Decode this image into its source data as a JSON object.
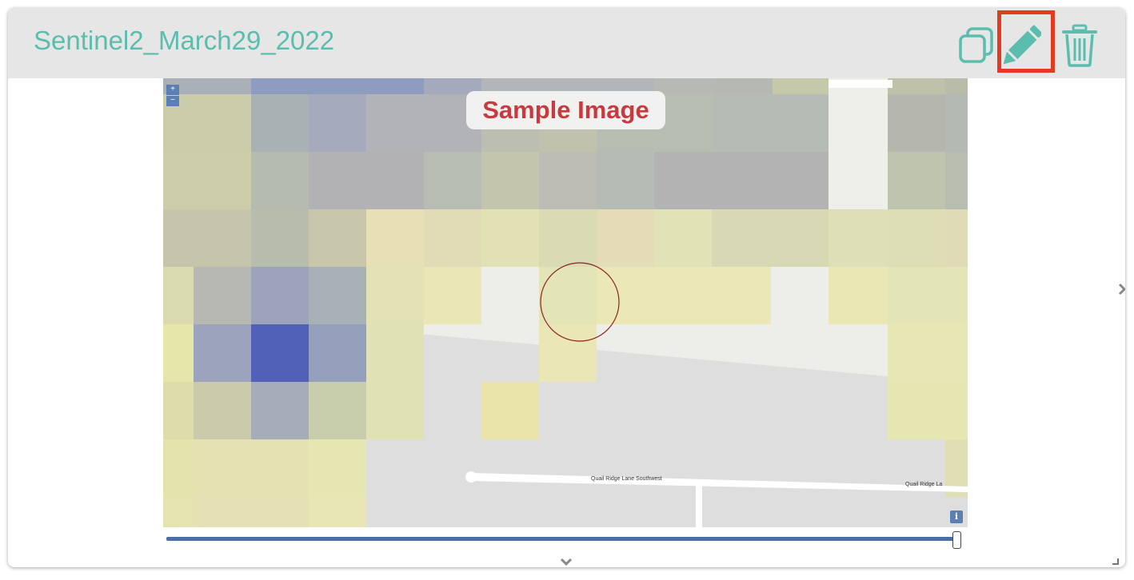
{
  "header": {
    "title": "Sentinel2_March29_2022",
    "accent_color": "#5bbdae",
    "highlight_color": "#e53a22",
    "actions": [
      {
        "icon": "copy-icon"
      },
      {
        "icon": "pencil-icon"
      },
      {
        "icon": "trash-icon"
      }
    ]
  },
  "map": {
    "overlay_label": "Sample Image",
    "zoom_in": "+",
    "zoom_out": "−",
    "street_1": "Quail Ridge Lane Southwest",
    "street_2": "Quail Ridge La",
    "info_label": "i"
  },
  "slider": {
    "value": 1.0
  },
  "icons": {
    "expand": "chevron-down-icon",
    "next": "chevron-right-icon",
    "resize": "resize-handle-icon"
  }
}
